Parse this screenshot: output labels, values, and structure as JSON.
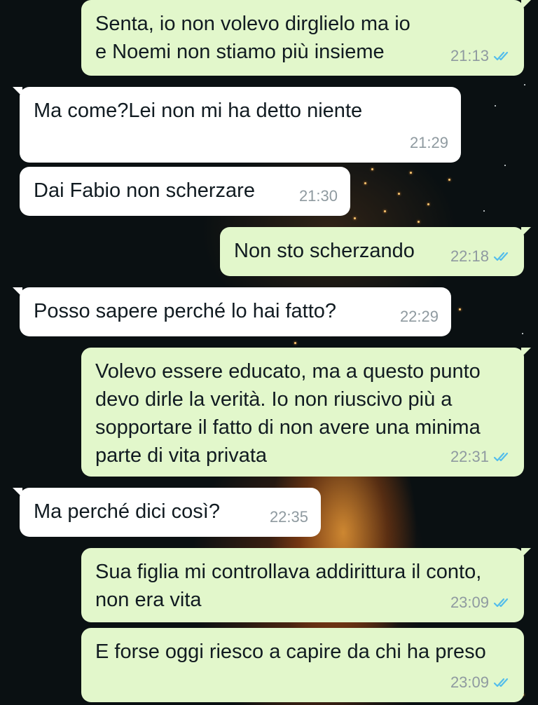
{
  "messages": [
    {
      "direction": "out",
      "text": "Senta, io non volevo dirglielo ma io e Noemi non stiamo più insieme",
      "time": "21:13",
      "status": "read"
    },
    {
      "direction": "in",
      "text": "Ma come?Lei non mi ha detto niente",
      "time": "21:29"
    },
    {
      "direction": "in",
      "text": "Dai Fabio non scherzare",
      "time": "21:30"
    },
    {
      "direction": "out",
      "text": "Non sto scherzando",
      "time": "22:18",
      "status": "read"
    },
    {
      "direction": "in",
      "text": "Posso sapere perché lo hai fatto?",
      "time": "22:29"
    },
    {
      "direction": "out",
      "text": "Volevo essere educato, ma a questo punto devo dirle la verità. Io non riuscivo più a sopportare il fatto di non avere una minima parte di vita privata",
      "time": "22:31",
      "status": "read"
    },
    {
      "direction": "in",
      "text": "Ma perché dici così?",
      "time": "22:35"
    },
    {
      "direction": "out",
      "text": "Sua figlia mi controllava addirittura il conto, non era vita",
      "time": "23:09",
      "status": "read"
    },
    {
      "direction": "out",
      "text": "E forse oggi riesco a capire da chi ha preso",
      "time": "23:09",
      "status": "read"
    }
  ],
  "colors": {
    "incoming_bubble": "#ffffff",
    "outgoing_bubble": "#e2f7cb",
    "timestamp": "#8f9aa0",
    "read_ticks": "#53bdeb"
  },
  "icons": {
    "read_receipt": "double-check-icon"
  }
}
